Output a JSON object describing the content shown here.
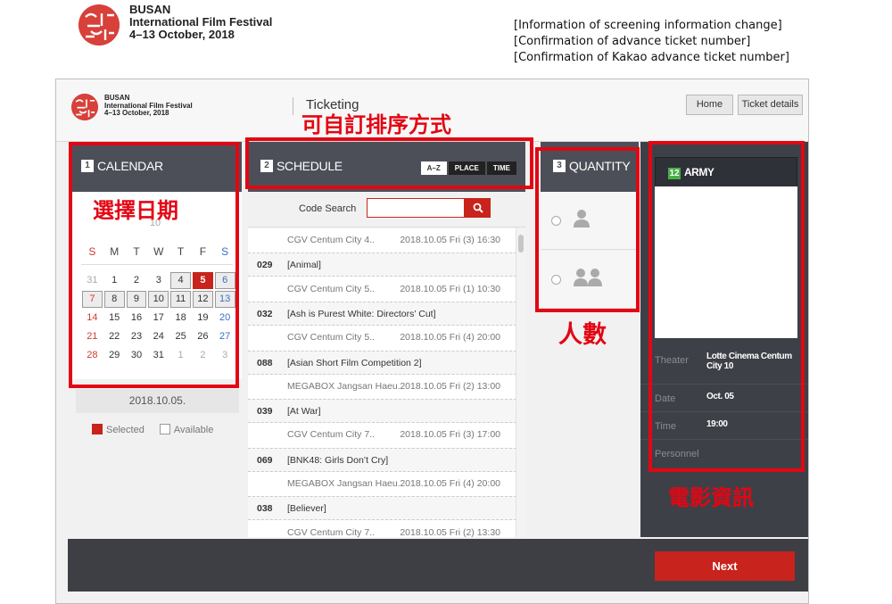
{
  "document_header": {
    "festival_lines": [
      "BUSAN",
      "International Film Festival",
      "4–13 October, 2018"
    ],
    "links": [
      "[Information of screening information change]",
      "[Confirmation of advance ticket number]",
      "[Confirmation of Kakao advance ticket number]"
    ]
  },
  "app": {
    "festival_lines": [
      "BUSAN",
      "International Film Festival",
      "4–13 October, 2018"
    ],
    "section_title": "Ticketing",
    "nav": {
      "home": "Home",
      "ticket_details": "Ticket details"
    }
  },
  "calendar": {
    "step": "1",
    "title": "CALENDAR",
    "month_label": "10",
    "weekdays": [
      "S",
      "M",
      "T",
      "W",
      "T",
      "F",
      "S"
    ],
    "weeks": [
      [
        "31",
        "1",
        "2",
        "3",
        "4",
        "5",
        "6"
      ],
      [
        "7",
        "8",
        "9",
        "10",
        "11",
        "12",
        "13"
      ],
      [
        "14",
        "15",
        "16",
        "17",
        "18",
        "19",
        "20"
      ],
      [
        "21",
        "22",
        "23",
        "24",
        "25",
        "26",
        "27"
      ],
      [
        "28",
        "29",
        "30",
        "31",
        "1",
        "2",
        "3"
      ]
    ],
    "selected_display": "2018.10.05.",
    "legend": {
      "selected": "Selected",
      "available": "Available"
    }
  },
  "schedule": {
    "step": "2",
    "title": "SCHEDULE",
    "sort_options": [
      "A–Z",
      "PLACE",
      "TIME"
    ],
    "code_search_label": "Code Search",
    "rows": [
      {
        "type": "show",
        "place": "CGV Centum City 4..",
        "time": "2018.10.05 Fri (3) 16:30"
      },
      {
        "type": "movie",
        "code": "029",
        "title": "[Animal]"
      },
      {
        "type": "show",
        "place": "CGV Centum City 5..",
        "time": "2018.10.05 Fri (1) 10:30"
      },
      {
        "type": "movie",
        "code": "032",
        "title": "[Ash is Purest White: Directors’ Cut]"
      },
      {
        "type": "show",
        "place": "CGV Centum City 5..",
        "time": "2018.10.05 Fri (4) 20:00"
      },
      {
        "type": "movie",
        "code": "088",
        "title": "[Asian Short Film Competition 2]"
      },
      {
        "type": "show",
        "place": "MEGABOX Jangsan Haeu..",
        "time": "2018.10.05 Fri (2) 13:00"
      },
      {
        "type": "movie",
        "code": "039",
        "title": "[At War]"
      },
      {
        "type": "show",
        "place": "CGV Centum City 7..",
        "time": "2018.10.05 Fri (3) 17:00"
      },
      {
        "type": "movie",
        "code": "069",
        "title": "[BNK48: Girls Don’t Cry]"
      },
      {
        "type": "show",
        "place": "MEGABOX Jangsan Haeu..",
        "time": "2018.10.05 Fri (4) 20:00"
      },
      {
        "type": "movie",
        "code": "038",
        "title": "[Believer]"
      },
      {
        "type": "show",
        "place": "CGV Centum City 7..",
        "time": "2018.10.05 Fri (2) 13:30"
      }
    ]
  },
  "quantity": {
    "step": "3",
    "title": "QUANTITY"
  },
  "movie_info": {
    "age_rating": "12",
    "title": "ARMY",
    "theater_label": "Theater",
    "theater_value": "Lotte Cinema Centum City 10",
    "date_label": "Date",
    "date_value": "Oct. 05",
    "time_label": "Time",
    "time_value": "19:00",
    "personnel_label": "Personnel"
  },
  "footer": {
    "next": "Next"
  },
  "annotations": {
    "sort_note": "可自訂排序方式",
    "calendar_note": "選擇日期",
    "quantity_note": "人數",
    "info_note": "電影資訊",
    "color": "#e30613"
  },
  "colors": {
    "accent_red": "#c8231c",
    "header_dark": "#4d4f58",
    "panel_dark": "#3e4048",
    "age_green": "#4ab04a"
  }
}
